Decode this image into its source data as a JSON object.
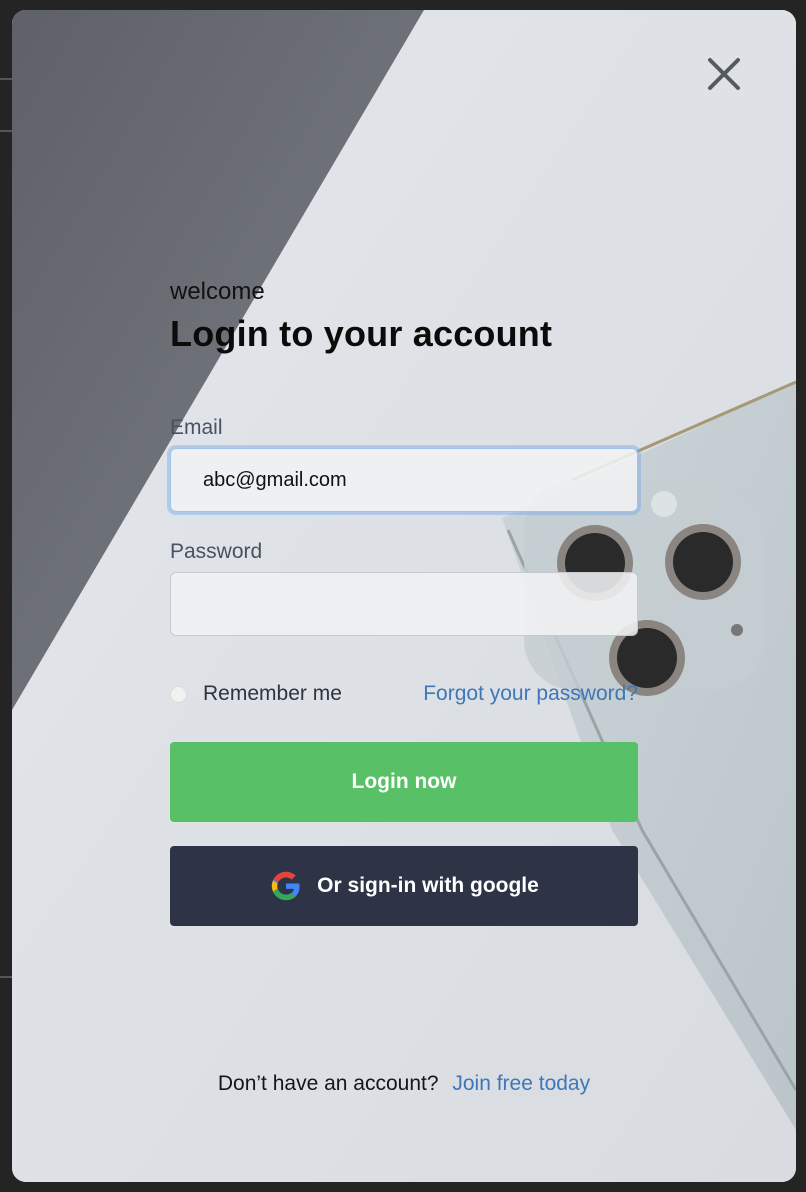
{
  "modal": {
    "greeting": "welcome",
    "title": "Login to your account",
    "email": {
      "label": "Email",
      "value": "abc@gmail.com",
      "placeholder": ""
    },
    "password": {
      "label": "Password",
      "value": "",
      "placeholder": ""
    },
    "remember_label": "Remember me",
    "forgot_label": "Forgot your password?",
    "login_label": "Login now",
    "google_label": "Or sign-in with google",
    "footer": {
      "prompt": "Don’t have an account?",
      "join_label": "Join free today"
    },
    "icons": {
      "close": "close-icon",
      "google": "google-g-icon"
    }
  },
  "colors": {
    "primary_green": "#58c167",
    "google_button": "#2e3446",
    "link": "#3d78b8",
    "input_focus": "#9ec4ee"
  }
}
